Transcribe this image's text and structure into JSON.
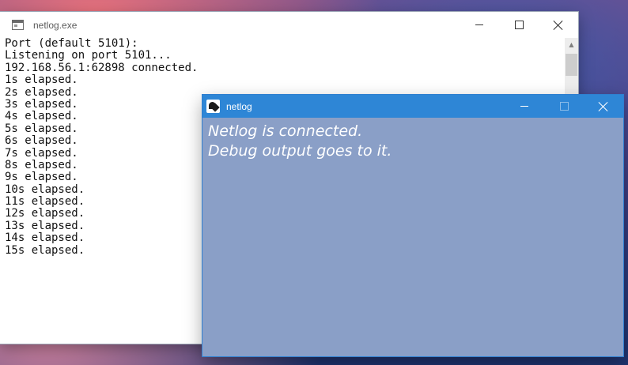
{
  "console_window": {
    "title": "netlog.exe",
    "icon": "console-window-icon",
    "controls": {
      "minimize": "minimize-icon",
      "maximize": "maximize-icon",
      "close": "close-icon"
    },
    "lines": [
      "Port (default 5101):",
      "Listening on port 5101...",
      "192.168.56.1:62898 connected.",
      "1s elapsed.",
      "2s elapsed.",
      "3s elapsed.",
      "4s elapsed.",
      "5s elapsed.",
      "6s elapsed.",
      "7s elapsed.",
      "8s elapsed.",
      "9s elapsed.",
      "10s elapsed.",
      "11s elapsed.",
      "12s elapsed.",
      "13s elapsed.",
      "14s elapsed.",
      "15s elapsed."
    ]
  },
  "netlog_window": {
    "title": "netlog",
    "icon": "netlog-app-icon",
    "accent_color": "#2e86d6",
    "background_color": "#8a9fc7",
    "controls": {
      "minimize": "minimize-icon",
      "maximize": "maximize-icon",
      "close": "close-icon"
    },
    "messages": [
      "Netlog is connected.",
      "Debug output goes to it."
    ]
  }
}
